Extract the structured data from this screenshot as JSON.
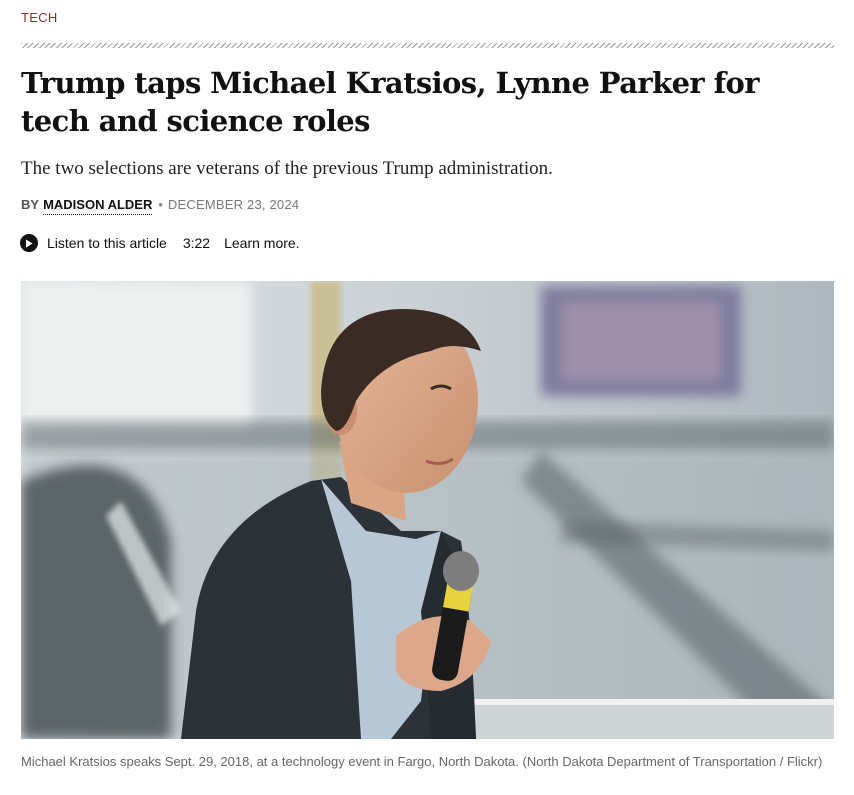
{
  "article": {
    "category": "TECH",
    "headline": "Trump taps Michael Kratsios, Lynne Parker for tech and science roles",
    "dek": "The two selections are veterans of the previous Trump administration.",
    "byline": {
      "prefix": "BY",
      "author": "MADISON ALDER",
      "separator": "•",
      "date": "DECEMBER 23, 2024"
    },
    "audio": {
      "icon": "play-icon",
      "label": "Listen to this article",
      "duration": "3:22",
      "learn_more": "Learn more."
    },
    "image": {
      "subject": "photo-man-speaking-into-microphone"
    },
    "caption": "Michael Kratsios speaks Sept. 29, 2018, at a technology event in Fargo, North Dakota. (North Dakota Department of Transportation / Flickr)"
  },
  "colors": {
    "category": "#9b2c2c",
    "text": "#111111",
    "muted": "#666666"
  }
}
